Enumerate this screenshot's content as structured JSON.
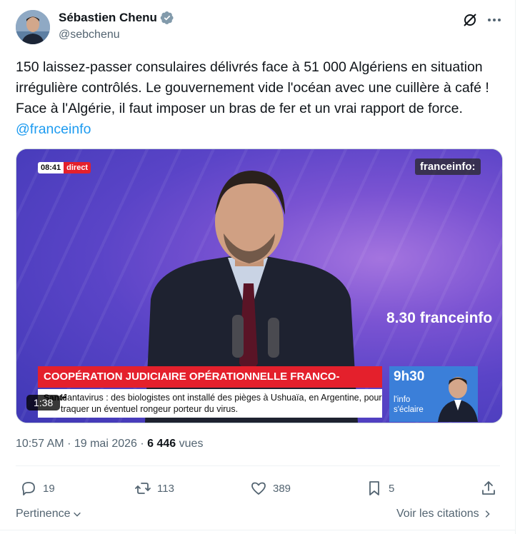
{
  "author": {
    "name": "Sébastien Chenu",
    "handle": "@sebchenu",
    "verified_color": "#829aab"
  },
  "tweet": {
    "text_main": "150 laissez-passer consulaires délivrés face à 51 000 Algériens en situation irrégulière contrôlés. Le gouvernement vide l'océan avec une cuillère à café ! Face à l'Algérie, il faut imposer un bras de fer et un vrai rapport de force.",
    "mention": "@franceinfo"
  },
  "video": {
    "live_time": "08:41",
    "live_label": "direct",
    "channel_logo": "franceinfo:",
    "show_brand": "8.30 franceinfo",
    "banner": "COOPÉRATION JUDICIAIRE OPÉRATIONNELLE FRANCO-ALGÉRIENNE",
    "ticker_category": "Santé",
    "ticker_text": "Hantavirus : des biologistes ont installé des pièges à Ushuaïa, en Argentine, pour traquer un éventuel rongeur porteur du virus.",
    "side_time": "9h30",
    "side_tag_line1": "l'info",
    "side_tag_line2": "s'éclaire",
    "duration": "1:38"
  },
  "meta": {
    "time": "10:57 AM",
    "dot": "·",
    "date": "19 mai 2026",
    "views_count": "6 446",
    "views_label": "vues"
  },
  "actions": {
    "replies": "19",
    "reposts": "113",
    "likes": "389",
    "bookmarks": "5"
  },
  "footer": {
    "sort_label": "Pertinence",
    "citations_label": "Voir les citations"
  },
  "colors": {
    "accent": "#1d9bf0",
    "banner_red": "#e4202c",
    "muted": "#536471"
  }
}
